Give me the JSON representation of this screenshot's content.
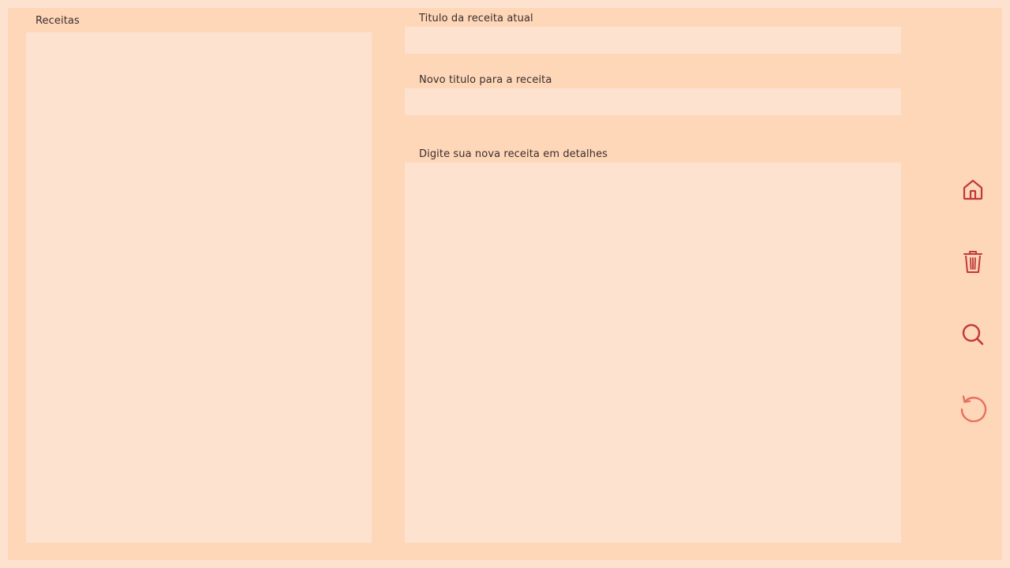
{
  "recipes": {
    "label": "Receitas",
    "items": []
  },
  "form": {
    "current_title_label": "Titulo da receita atual",
    "current_title_value": "",
    "new_title_label": "Novo titulo para a receita",
    "new_title_value": "",
    "details_label": "Digite sua nova receita em detalhes",
    "details_value": ""
  },
  "actions": [
    {
      "icon": "home-icon",
      "color": "#c0393b"
    },
    {
      "icon": "trash-icon",
      "color": "#c0393b"
    },
    {
      "icon": "search-icon",
      "color": "#c0393b"
    },
    {
      "icon": "refresh-icon",
      "color": "#e8705f"
    }
  ],
  "colors": {
    "page_background": "#fde3cf",
    "frame_background": "#fed6b8",
    "panel_background": "#fde3cf",
    "icon_primary": "#c0393b",
    "icon_secondary": "#e8705f",
    "text": "#3a2e2e"
  }
}
